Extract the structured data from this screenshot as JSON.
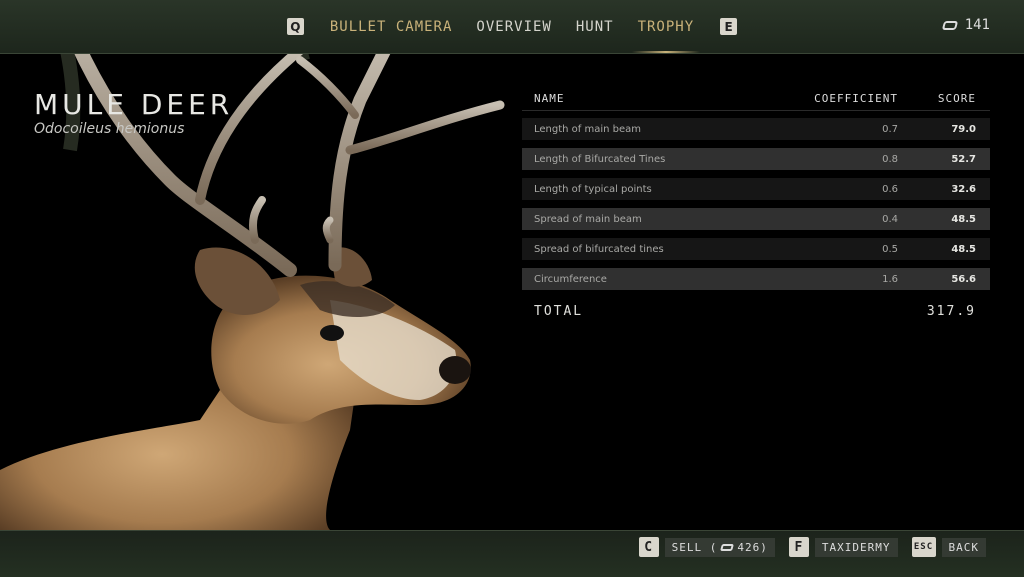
{
  "nav": {
    "left_key": "Q",
    "right_key": "E",
    "tabs": [
      "BULLET CAMERA",
      "OVERVIEW",
      "HUNT",
      "TROPHY"
    ],
    "active_tab": "TROPHY"
  },
  "currency": {
    "icon": "money-icon",
    "amount": "141"
  },
  "animal": {
    "name": "MULE DEER",
    "latin": "Odocoileus hemionus"
  },
  "table": {
    "headers": {
      "name": "NAME",
      "coefficient": "COEFFICIENT",
      "score": "SCORE"
    },
    "rows": [
      {
        "name": "Length of main beam",
        "coefficient": "0.7",
        "score": "79.0"
      },
      {
        "name": "Length of Bifurcated Tines",
        "coefficient": "0.8",
        "score": "52.7"
      },
      {
        "name": "Length of typical points",
        "coefficient": "0.6",
        "score": "32.6"
      },
      {
        "name": "Spread of main beam",
        "coefficient": "0.4",
        "score": "48.5"
      },
      {
        "name": "Spread of bifurcated tines",
        "coefficient": "0.5",
        "score": "48.5"
      },
      {
        "name": "Circumference",
        "coefficient": "1.6",
        "score": "56.6"
      }
    ],
    "total_label": "TOTAL",
    "total_value": "317.9"
  },
  "actions": {
    "sell": {
      "key": "C",
      "label": "SELL (",
      "amount": "426)"
    },
    "taxidermy": {
      "key": "F",
      "label": "TAXIDERMY"
    },
    "back": {
      "key": "ESC",
      "label": "BACK"
    }
  },
  "colors": {
    "accent": "#c9b27a",
    "bar": "#243022"
  }
}
